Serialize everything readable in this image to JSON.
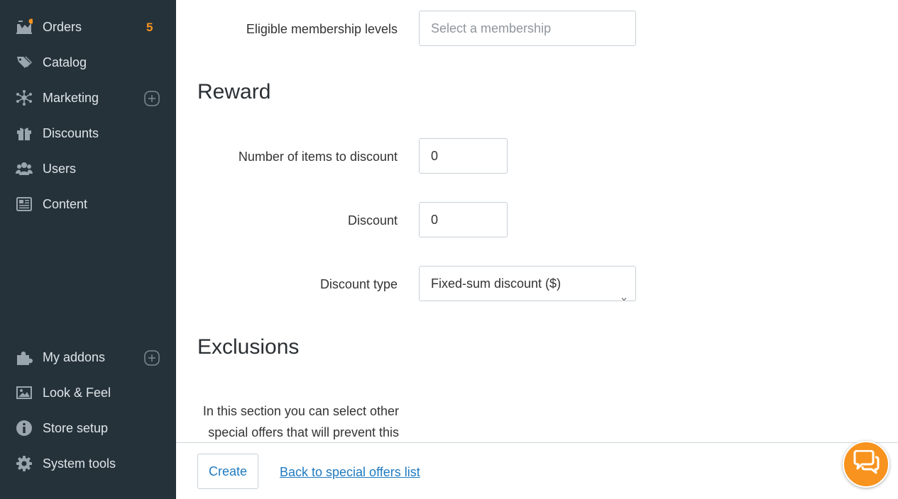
{
  "sidebar": {
    "background": "#26323a",
    "items": [
      {
        "label": "Orders",
        "icon": "orders-icon",
        "badge": "5"
      },
      {
        "label": "Catalog",
        "icon": "tag-icon"
      },
      {
        "label": "Marketing",
        "icon": "network-icon"
      },
      {
        "label": "Discounts",
        "icon": "gift-icon"
      },
      {
        "label": "Users",
        "icon": "users-icon"
      },
      {
        "label": "Content",
        "icon": "newspaper-icon"
      },
      {
        "label": "My addons",
        "icon": "puzzle-icon"
      },
      {
        "label": "Look & Feel",
        "icon": "image-icon"
      },
      {
        "label": "Store setup",
        "icon": "info-icon"
      },
      {
        "label": "System tools",
        "icon": "gear-icon"
      }
    ]
  },
  "form": {
    "membership": {
      "label": "Eligible membership levels",
      "placeholder": "Select a membership"
    },
    "reward_title": "Reward",
    "items_to_discount": {
      "label": "Number of items to discount",
      "value": "0"
    },
    "discount": {
      "label": "Discount",
      "value": "0"
    },
    "discount_type": {
      "label": "Discount type",
      "value": "Fixed-sum discount ($)"
    },
    "exclusions_title": "Exclusions",
    "exclusions_help_line1": "In this section you can select other",
    "exclusions_help_line2": "special offers that will prevent this"
  },
  "footer": {
    "create_label": "Create",
    "back_link": "Back to special offers list"
  },
  "colors": {
    "accent": "#f7931e",
    "link": "#1f7ac0"
  },
  "chat": {
    "icon": "chat-bubbles-icon"
  }
}
